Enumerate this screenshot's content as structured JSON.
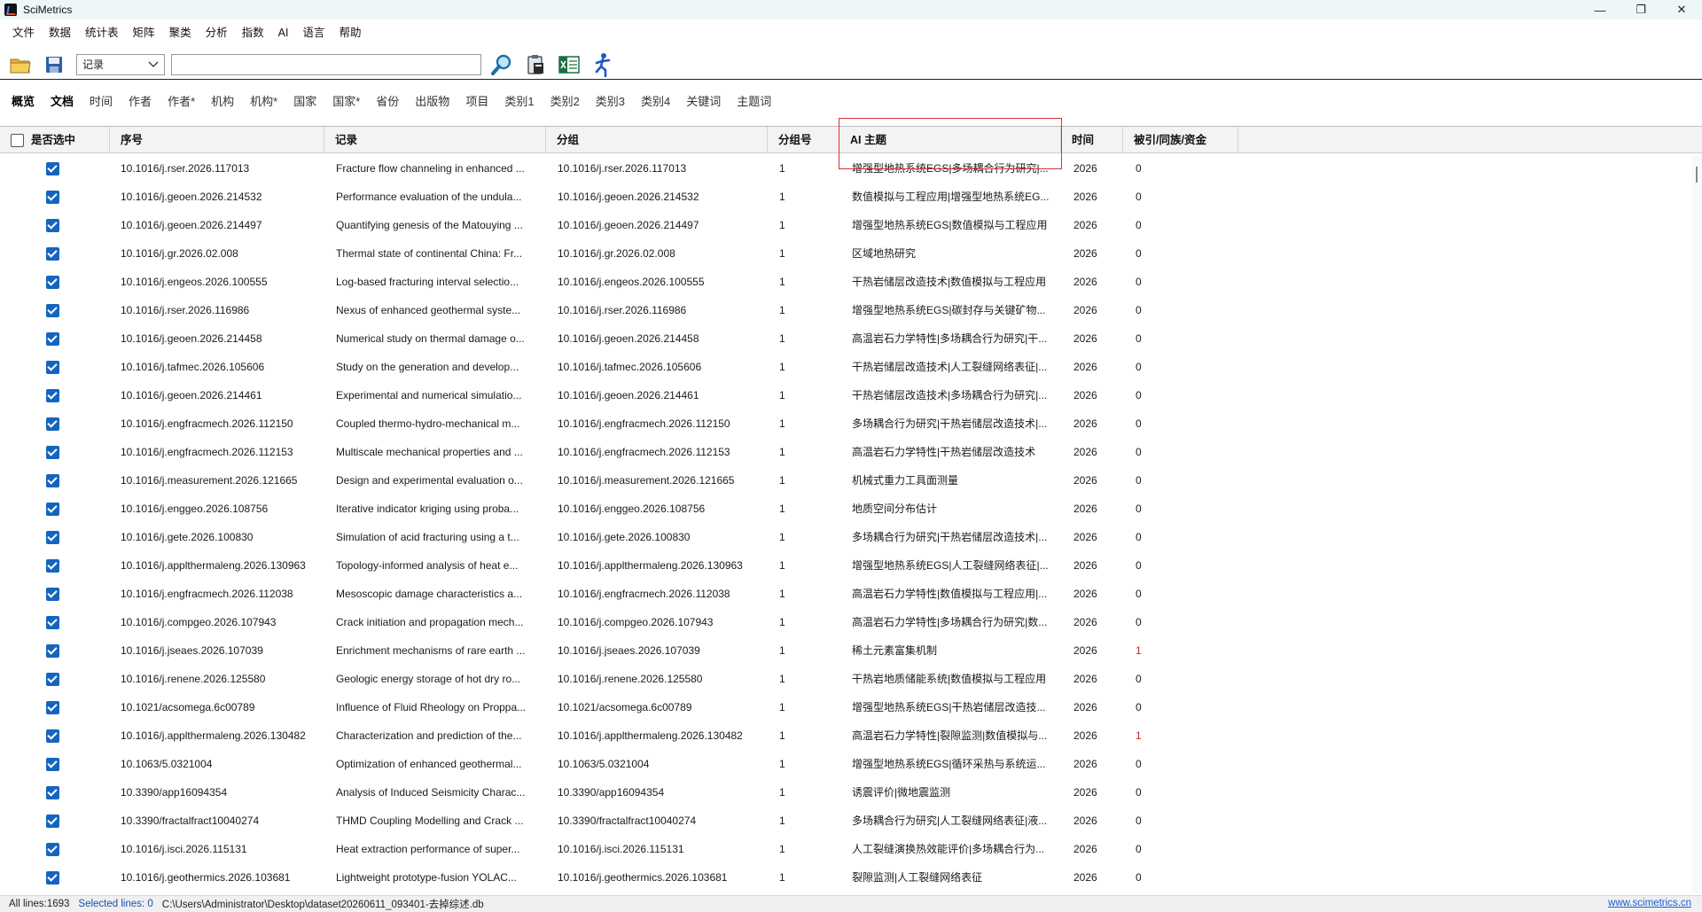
{
  "window": {
    "title": "SciMetrics"
  },
  "menu": [
    "文件",
    "数据",
    "统计表",
    "矩阵",
    "聚类",
    "分析",
    "指数",
    "AI",
    "语言",
    "帮助"
  ],
  "toolbar": {
    "select_value": "记录",
    "search_value": ""
  },
  "tabs": [
    {
      "label": "概览",
      "active": false
    },
    {
      "label": "文档",
      "active": true
    },
    {
      "label": "时间",
      "active": false
    },
    {
      "label": "作者",
      "active": false
    },
    {
      "label": "作者*",
      "active": false
    },
    {
      "label": "机构",
      "active": false
    },
    {
      "label": "机构*",
      "active": false
    },
    {
      "label": "国家",
      "active": false
    },
    {
      "label": "国家*",
      "active": false
    },
    {
      "label": "省份",
      "active": false
    },
    {
      "label": "出版物",
      "active": false
    },
    {
      "label": "项目",
      "active": false
    },
    {
      "label": "类别1",
      "active": false
    },
    {
      "label": "类别2",
      "active": false
    },
    {
      "label": "类别3",
      "active": false
    },
    {
      "label": "类别4",
      "active": false
    },
    {
      "label": "关键词",
      "active": false
    },
    {
      "label": "主题词",
      "active": false
    }
  ],
  "table": {
    "columns": [
      "是否选中",
      "序号",
      "记录",
      "分组",
      "分组号",
      "AI 主题",
      "时间",
      "被引/同族/资金"
    ],
    "rows": [
      {
        "id": "10.1016/j.rser.2026.117013",
        "record": "Fracture flow channeling in enhanced ...",
        "group": "10.1016/j.rser.2026.117013",
        "gno": "1",
        "topic": "增强型地热系统EGS|多场耦合行为研究|...",
        "year": "2026",
        "cited": "0"
      },
      {
        "id": "10.1016/j.geoen.2026.214532",
        "record": "Performance evaluation of the undula...",
        "group": "10.1016/j.geoen.2026.214532",
        "gno": "1",
        "topic": "数值模拟与工程应用|增强型地热系统EG...",
        "year": "2026",
        "cited": "0"
      },
      {
        "id": "10.1016/j.geoen.2026.214497",
        "record": "Quantifying genesis of the Matouying ...",
        "group": "10.1016/j.geoen.2026.214497",
        "gno": "1",
        "topic": "增强型地热系统EGS|数值模拟与工程应用",
        "year": "2026",
        "cited": "0"
      },
      {
        "id": "10.1016/j.gr.2026.02.008",
        "record": "Thermal state of continental China: Fr...",
        "group": "10.1016/j.gr.2026.02.008",
        "gno": "1",
        "topic": "区域地热研究",
        "year": "2026",
        "cited": "0"
      },
      {
        "id": "10.1016/j.engeos.2026.100555",
        "record": "Log-based fracturing interval selectio...",
        "group": "10.1016/j.engeos.2026.100555",
        "gno": "1",
        "topic": "干热岩储层改造技术|数值模拟与工程应用",
        "year": "2026",
        "cited": "0"
      },
      {
        "id": "10.1016/j.rser.2026.116986",
        "record": "Nexus of enhanced geothermal syste...",
        "group": "10.1016/j.rser.2026.116986",
        "gno": "1",
        "topic": "增强型地热系统EGS|碳封存与关键矿物...",
        "year": "2026",
        "cited": "0"
      },
      {
        "id": "10.1016/j.geoen.2026.214458",
        "record": "Numerical study on thermal damage o...",
        "group": "10.1016/j.geoen.2026.214458",
        "gno": "1",
        "topic": "高温岩石力学特性|多场耦合行为研究|干...",
        "year": "2026",
        "cited": "0"
      },
      {
        "id": "10.1016/j.tafmec.2026.105606",
        "record": "Study on the generation and develop...",
        "group": "10.1016/j.tafmec.2026.105606",
        "gno": "1",
        "topic": "干热岩储层改造技术|人工裂缝网络表征|...",
        "year": "2026",
        "cited": "0"
      },
      {
        "id": "10.1016/j.geoen.2026.214461",
        "record": "Experimental and numerical simulatio...",
        "group": "10.1016/j.geoen.2026.214461",
        "gno": "1",
        "topic": "干热岩储层改造技术|多场耦合行为研究|...",
        "year": "2026",
        "cited": "0"
      },
      {
        "id": "10.1016/j.engfracmech.2026.112150",
        "record": "Coupled thermo-hydro-mechanical m...",
        "group": "10.1016/j.engfracmech.2026.112150",
        "gno": "1",
        "topic": "多场耦合行为研究|干热岩储层改造技术|...",
        "year": "2026",
        "cited": "0"
      },
      {
        "id": "10.1016/j.engfracmech.2026.112153",
        "record": "Multiscale mechanical properties and ...",
        "group": "10.1016/j.engfracmech.2026.112153",
        "gno": "1",
        "topic": "高温岩石力学特性|干热岩储层改造技术",
        "year": "2026",
        "cited": "0"
      },
      {
        "id": "10.1016/j.measurement.2026.121665",
        "record": "Design and experimental evaluation o...",
        "group": "10.1016/j.measurement.2026.121665",
        "gno": "1",
        "topic": "机械式重力工具面测量",
        "year": "2026",
        "cited": "0"
      },
      {
        "id": "10.1016/j.enggeo.2026.108756",
        "record": "Iterative indicator kriging using proba...",
        "group": "10.1016/j.enggeo.2026.108756",
        "gno": "1",
        "topic": "地质空间分布估计",
        "year": "2026",
        "cited": "0"
      },
      {
        "id": "10.1016/j.gete.2026.100830",
        "record": "Simulation of acid fracturing using a t...",
        "group": "10.1016/j.gete.2026.100830",
        "gno": "1",
        "topic": "多场耦合行为研究|干热岩储层改造技术|...",
        "year": "2026",
        "cited": "0"
      },
      {
        "id": "10.1016/j.applthermaleng.2026.130963",
        "record": "Topology-informed analysis of heat e...",
        "group": "10.1016/j.applthermaleng.2026.130963",
        "gno": "1",
        "topic": "增强型地热系统EGS|人工裂缝网络表征|...",
        "year": "2026",
        "cited": "0"
      },
      {
        "id": "10.1016/j.engfracmech.2026.112038",
        "record": "Mesoscopic damage characteristics a...",
        "group": "10.1016/j.engfracmech.2026.112038",
        "gno": "1",
        "topic": "高温岩石力学特性|数值模拟与工程应用|...",
        "year": "2026",
        "cited": "0"
      },
      {
        "id": "10.1016/j.compgeo.2026.107943",
        "record": "Crack initiation and propagation mech...",
        "group": "10.1016/j.compgeo.2026.107943",
        "gno": "1",
        "topic": "高温岩石力学特性|多场耦合行为研究|数...",
        "year": "2026",
        "cited": "0"
      },
      {
        "id": "10.1016/j.jseaes.2026.107039",
        "record": "Enrichment mechanisms of rare earth ...",
        "group": "10.1016/j.jseaes.2026.107039",
        "gno": "1",
        "topic": "稀土元素富集机制",
        "year": "2026",
        "cited": "1"
      },
      {
        "id": "10.1016/j.renene.2026.125580",
        "record": "Geologic energy storage of hot dry ro...",
        "group": "10.1016/j.renene.2026.125580",
        "gno": "1",
        "topic": "干热岩地质储能系统|数值模拟与工程应用",
        "year": "2026",
        "cited": "0"
      },
      {
        "id": "10.1021/acsomega.6c00789",
        "record": "Influence of Fluid Rheology on Proppa...",
        "group": "10.1021/acsomega.6c00789",
        "gno": "1",
        "topic": "增强型地热系统EGS|干热岩储层改造技...",
        "year": "2026",
        "cited": "0"
      },
      {
        "id": "10.1016/j.applthermaleng.2026.130482",
        "record": "Characterization and prediction of the...",
        "group": "10.1016/j.applthermaleng.2026.130482",
        "gno": "1",
        "topic": "高温岩石力学特性|裂隙监测|数值模拟与...",
        "year": "2026",
        "cited": "1"
      },
      {
        "id": "10.1063/5.0321004",
        "record": "Optimization of enhanced geothermal...",
        "group": "10.1063/5.0321004",
        "gno": "1",
        "topic": "增强型地热系统EGS|循环采热与系统运...",
        "year": "2026",
        "cited": "0"
      },
      {
        "id": "10.3390/app16094354",
        "record": "Analysis of Induced Seismicity Charac...",
        "group": "10.3390/app16094354",
        "gno": "1",
        "topic": "诱震评价|微地震监测",
        "year": "2026",
        "cited": "0"
      },
      {
        "id": "10.3390/fractalfract10040274",
        "record": "THMD Coupling Modelling and Crack ...",
        "group": "10.3390/fractalfract10040274",
        "gno": "1",
        "topic": "多场耦合行为研究|人工裂缝网络表征|液...",
        "year": "2026",
        "cited": "0"
      },
      {
        "id": "10.1016/j.isci.2026.115131",
        "record": "Heat extraction performance of super...",
        "group": "10.1016/j.isci.2026.115131",
        "gno": "1",
        "topic": "人工裂缝演换热效能评价|多场耦合行为...",
        "year": "2026",
        "cited": "0"
      },
      {
        "id": "10.1016/j.geothermics.2026.103681",
        "record": "Lightweight prototype-fusion YOLAC...",
        "group": "10.1016/j.geothermics.2026.103681",
        "gno": "1",
        "topic": "裂隙监测|人工裂缝网络表征",
        "year": "2026",
        "cited": "0"
      }
    ]
  },
  "status": {
    "all_lines": "All lines:1693",
    "selected_lines": "Selected lines: 0",
    "path": "C:\\Users\\Administrator\\Desktop\\dataset20260611_093401-去掉综述.db",
    "link": "www.scimetrics.cn"
  },
  "colors": {
    "accent": "#1565c0",
    "highlight_box": "#e03030",
    "cited_nonzero": "#c62828"
  }
}
